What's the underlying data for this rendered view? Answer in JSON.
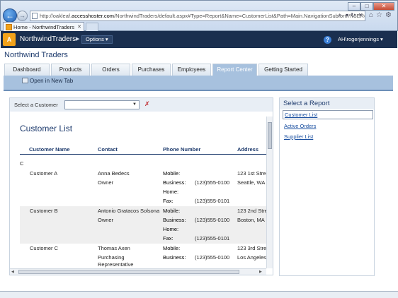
{
  "browser": {
    "url_prefix": "http://oakleaf.",
    "url_domain": "accesshoster.com",
    "url_rest": "/NorthwindTraders/default.aspx#Type=Report&Name=CustomerList&Path=Main.NavigationSubform%3EReport",
    "tab_title": "Home - NorthwindTraders",
    "tab_close": "✕",
    "back_icon": "←",
    "forward_icon": "→",
    "window_min": "–",
    "window_max": "□",
    "window_close": "✕",
    "addr_search": "⌕",
    "addr_dropdown": "▾",
    "addr_refresh": "↻",
    "addr_stop": "✕",
    "tool_icons": "⌂☆⚙"
  },
  "app": {
    "logo": "A",
    "title": "NorthwindTraders",
    "caret": "▶",
    "options_label": "Options ▾",
    "help_icon": "?",
    "user": "AH\\rogerjennings ▾"
  },
  "site": {
    "title": "Northwind Traders",
    "tabs": [
      {
        "label": "Dashboard"
      },
      {
        "label": "Products"
      },
      {
        "label": "Orders"
      },
      {
        "label": "Purchases"
      },
      {
        "label": "Employees"
      },
      {
        "label": "Report Center"
      },
      {
        "label": "Getting Started"
      }
    ],
    "open_new_tab": "Open in New Tab"
  },
  "filter": {
    "label": "Select a Customer",
    "value": "",
    "arrow": "▼",
    "clear_icon": "✗"
  },
  "report": {
    "title": "Customer List",
    "columns": [
      "Customer Name",
      "Contact",
      "Phone Number",
      "Address"
    ],
    "group_letter": "C",
    "customers": [
      {
        "name": "Customer A",
        "contact": [
          "Anna Bedecs",
          "Owner"
        ],
        "phones": [
          {
            "label": "Mobile:",
            "value": ""
          },
          {
            "label": "Business:",
            "value": "(123)555-0100"
          },
          {
            "label": "Home:",
            "value": ""
          },
          {
            "label": "Fax:",
            "value": "(123)555-0101"
          }
        ],
        "address": [
          "123 1st Stree",
          "Seattle, WA"
        ]
      },
      {
        "name": "Customer B",
        "contact": [
          "Antonio Gratacos Solsona",
          "Owner"
        ],
        "phones": [
          {
            "label": "Mobile:",
            "value": ""
          },
          {
            "label": "Business:",
            "value": "(123)555-0100"
          },
          {
            "label": "Home:",
            "value": ""
          },
          {
            "label": "Fax:",
            "value": "(123)555-0101"
          }
        ],
        "address": [
          "123 2nd Stre",
          "Boston, MA"
        ]
      },
      {
        "name": "Customer C",
        "contact": [
          "Thomas Axen",
          "Purchasing",
          "Representative"
        ],
        "phones": [
          {
            "label": "Mobile:",
            "value": ""
          },
          {
            "label": "Business:",
            "value": "(123)555-0100"
          }
        ],
        "address": [
          "123 3rd Stre",
          "Los Angeles,"
        ]
      }
    ]
  },
  "reports_panel": {
    "title": "Select a Report",
    "links": [
      "Customer List",
      "Active Orders",
      "Supplier List"
    ]
  },
  "colors": {
    "header_bg": "#1a2f4f",
    "accent": "#a7c1de",
    "title_blue": "#1f3c6e",
    "link_blue": "#1a4fa0",
    "row_shade": "#efefef"
  }
}
